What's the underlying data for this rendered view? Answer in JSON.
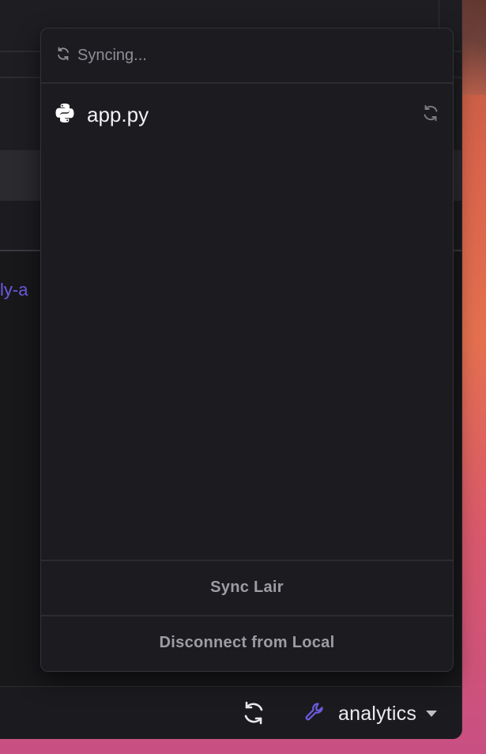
{
  "popover": {
    "status_text": "Syncing...",
    "files": [
      {
        "name": "app.py",
        "icon": "python-icon",
        "status_icon": "sync-icon"
      }
    ],
    "actions": {
      "sync_label": "Sync Lair",
      "disconnect_label": "Disconnect from Local"
    }
  },
  "background": {
    "peek_link_text": "ly-a"
  },
  "status_bar": {
    "sync_icon": "sync-icon",
    "env_icon": "wrench-icon",
    "env_label": "analytics",
    "env_caret_icon": "caret-down-icon"
  },
  "colors": {
    "accent": "#6c5ce0",
    "popover_bg": "#1c1c20",
    "text_primary": "#f2f2f5",
    "text_muted": "#8e8e95"
  }
}
